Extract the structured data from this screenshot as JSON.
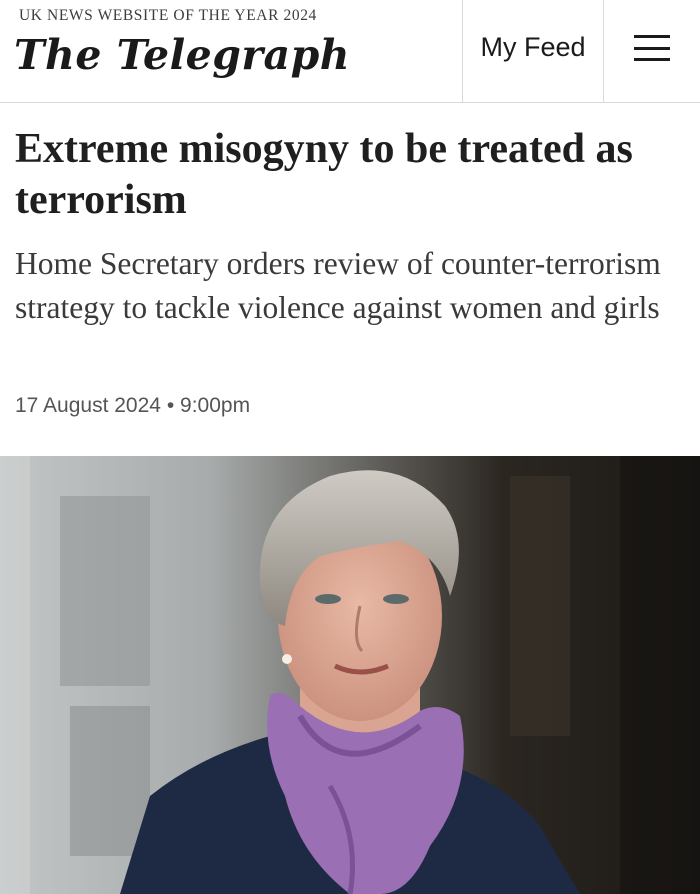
{
  "header": {
    "tagline": "UK NEWS WEBSITE OF THE YEAR 2024",
    "logo": "The Telegraph",
    "my_feed": "My Feed",
    "menu_icon": "hamburger-menu-icon"
  },
  "article": {
    "headline": "Extreme misogyny to be treated as terrorism",
    "standfirst": "Home Secretary orders review of counter-terrorism strategy to tackle violence against women and girls",
    "date": "17 August 2024",
    "separator": "•",
    "time": "9:00pm"
  },
  "photo": {
    "subject": "portrait of woman with short grey hair wearing purple scarf and navy coat"
  },
  "colors": {
    "text": "#1a1a1a",
    "scarf": "#9a6fb3",
    "coat": "#1e2a44"
  }
}
